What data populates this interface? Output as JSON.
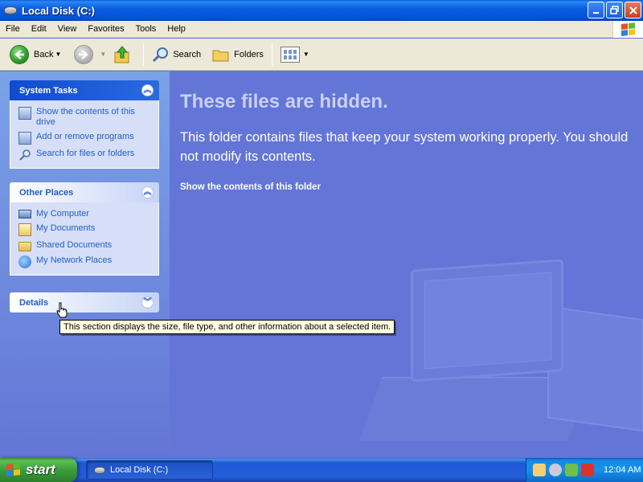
{
  "window": {
    "title": "Local Disk (C:)"
  },
  "menu": [
    "File",
    "Edit",
    "View",
    "Favorites",
    "Tools",
    "Help"
  ],
  "toolbar": {
    "back_label": "Back",
    "search_label": "Search",
    "folders_label": "Folders"
  },
  "left_pane": {
    "system_tasks": {
      "title": "System Tasks",
      "items": [
        {
          "label": "Show the contents of this drive",
          "icon": "show-contents-icon"
        },
        {
          "label": "Add or remove programs",
          "icon": "programs-icon"
        },
        {
          "label": "Search for files or folders",
          "icon": "search-icon"
        }
      ]
    },
    "other_places": {
      "title": "Other Places",
      "items": [
        {
          "label": "My Computer",
          "icon": "computer-icon"
        },
        {
          "label": "My Documents",
          "icon": "documents-icon"
        },
        {
          "label": "Shared Documents",
          "icon": "folder-icon"
        },
        {
          "label": "My Network Places",
          "icon": "network-icon"
        }
      ]
    },
    "details": {
      "title": "Details"
    }
  },
  "main": {
    "title": "These files are hidden.",
    "message": "This folder contains files that keep your system working properly. You should not modify its contents.",
    "link": "Show the contents of this folder"
  },
  "tooltip": "This section displays the size, file type, and other information about a selected item.",
  "taskbar": {
    "start_label": "start",
    "task_item": "Local Disk (C:)",
    "clock": "12:04 AM"
  },
  "colors": {
    "title_bar": "#0552d6",
    "pane_background": "#6375d6",
    "link_blue": "#215dc6",
    "start_green": "#3a9d3a"
  }
}
